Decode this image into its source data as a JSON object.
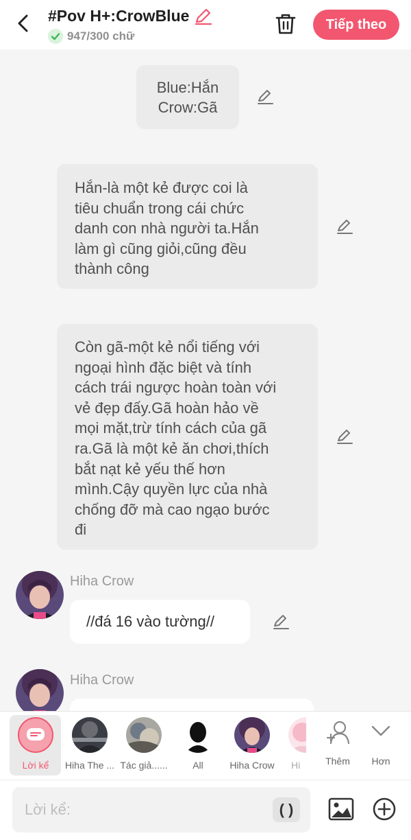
{
  "header": {
    "title": "#Pov H+:CrowBlue",
    "word_count": "947/300 chữ",
    "next_label": "Tiếp theo"
  },
  "messages": {
    "narration_1": [
      "Blue:Hắn",
      "Crow:Gã"
    ],
    "narration_2": [
      "Hắn-là một kẻ được coi là",
      "tiêu chuẩn trong cái chức",
      "danh con nhà người ta.Hắn",
      "làm gì cũng giỏi,cũng đều",
      "thành công"
    ],
    "narration_3": [
      "Còn gã-một kẻ nổi tiếng với",
      "ngoại hình đặc biệt và tính",
      "cách trái ngược hoàn toàn với",
      "vẻ đẹp đấy.Gã hoàn hảo về",
      "mọi mặt,trừ tính cách của gã",
      "ra.Gã là một kẻ ăn chơi,thích",
      "bắt nạt kẻ yếu thế hơn",
      "mình.Cậy quyền lực của nhà",
      "chống đỡ mà cao ngạo bước",
      "đi"
    ],
    "chat_1": {
      "name": "Hiha Crow",
      "text": "//đá 16 vào tường//"
    },
    "chat_2": {
      "name": "Hiha Crow"
    }
  },
  "characters": [
    {
      "label": "Lời kể",
      "icon": "narration-icon",
      "selected": true
    },
    {
      "label": "Hiha The ..."
    },
    {
      "label": "Tác giả......"
    },
    {
      "label": "All"
    },
    {
      "label": "Hiha Crow"
    },
    {
      "label": "Hi"
    },
    {
      "label": "Thêm",
      "icon": "add-user-icon"
    },
    {
      "label": "Hơn",
      "icon": "chevron-down-icon"
    }
  ],
  "input": {
    "placeholder": "Lời kể:",
    "paren_label": "( )"
  },
  "colors": {
    "accent": "#f2576f",
    "check": "#3cb55a"
  }
}
